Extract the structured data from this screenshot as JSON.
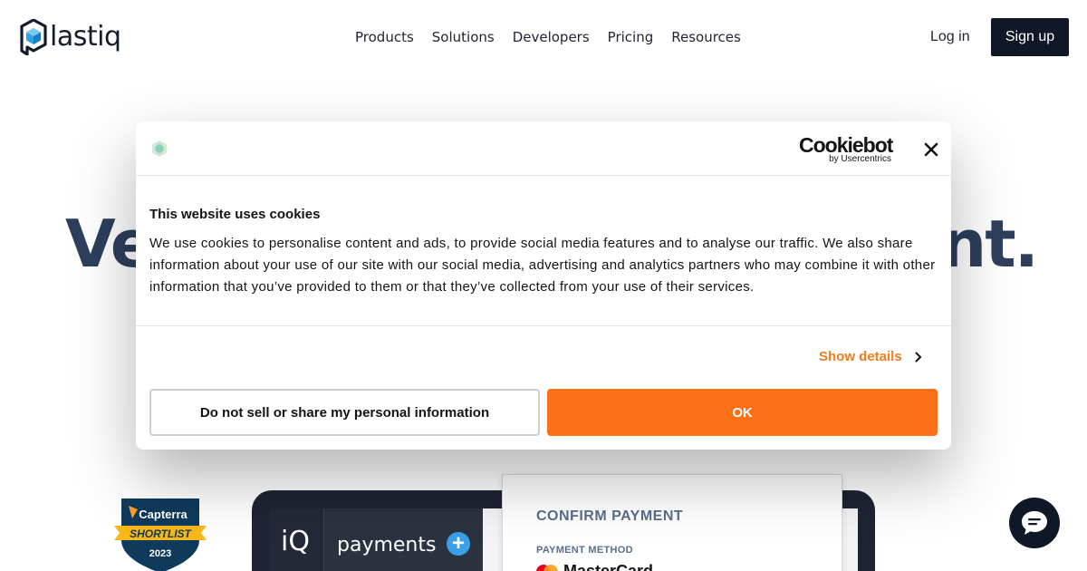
{
  "header": {
    "logo_text": "lastiq",
    "nav": [
      "Products",
      "Solutions",
      "Developers",
      "Pricing",
      "Resources"
    ],
    "login_label": "Log in",
    "signup_label": "Sign up"
  },
  "hero": {
    "headline_left": "Ve",
    "headline_right": "nt."
  },
  "badge": {
    "brand": "Capterra",
    "ribbon": "SHORTLIST",
    "year": "2023"
  },
  "mockup": {
    "iq": "iQ",
    "payments": "payments",
    "plus": "+",
    "confirm_title": "CONFIRM PAYMENT",
    "method_label": "PAYMENT METHOD",
    "card_text": "MasterCard"
  },
  "cookie_dialog": {
    "brand_main": "Cookiebot",
    "brand_sub": "by Usercentrics",
    "title": "This website uses cookies",
    "body": "We use cookies to personalise content and ads, to provide social media features and to analyse our traffic. We also share information about your use of our site with our social media, advertising and analytics partners who may combine it with other information that you’ve provided to them or that they’ve collected from your use of their services.",
    "show_details_label": "Show details",
    "do_not_sell_label": "Do not sell or share my personal information",
    "ok_label": "OK"
  },
  "icons": {
    "logo": "plastiq-cube-logo",
    "close": "close-icon",
    "chevron": "chevron-right-icon",
    "chat": "chat-icon"
  },
  "colors": {
    "accent_orange": "#fb6f17",
    "link_orange": "#f07c1b",
    "dark_navy": "#101827",
    "hero_text": "#2d3f5c",
    "logo_blue": "#2ea3ea"
  }
}
